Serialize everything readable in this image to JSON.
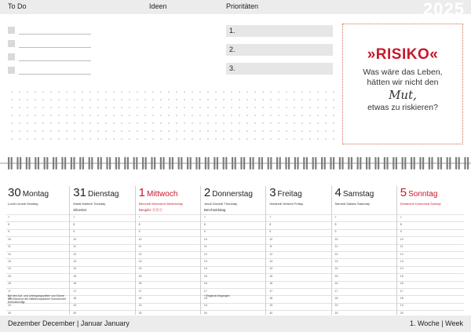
{
  "header": {
    "todo_label": "To Do",
    "ideen_label": "Ideen",
    "prioritaeten_label": "Prioritäten",
    "year": "2025"
  },
  "todo": {
    "count": 4
  },
  "priorities": [
    "1.",
    "2.",
    "3."
  ],
  "quote": {
    "title": "»RISIKO«",
    "line1": "Was wäre das Leben,",
    "line2": "hätten wir nicht den",
    "mut": "Mut,",
    "line3": "etwas zu riskieren?"
  },
  "days": [
    {
      "num": "30",
      "name": "Montag",
      "sub": "Lundi  Lunedì  Monday",
      "event": "",
      "red": false,
      "note": "Bei den Auf- und Untergangszeiten von Sonne und Mond ist die mitteleuropäische Sommerzeit berücksichtigt."
    },
    {
      "num": "31",
      "name": "Dienstag",
      "sub": "Mardi  Martedì  Tuesday",
      "event": "Silvester",
      "red": false,
      "note": ""
    },
    {
      "num": "1",
      "name": "Mittwoch",
      "sub": "Mercredi  Mercoledì  Wednesday",
      "event": "Neujahr  ⓐⓑⓒ",
      "red": true,
      "note": ""
    },
    {
      "num": "2",
      "name": "Donnerstag",
      "sub": "Jeudi  Giovedì  Thursday",
      "event": "Berchtoldstag",
      "red": false,
      "note": "* Regional begangen"
    },
    {
      "num": "3",
      "name": "Freitag",
      "sub": "Vendredi  Venerdì  Friday",
      "event": "",
      "red": false,
      "note": ""
    },
    {
      "num": "4",
      "name": "Samstag",
      "sub": "Samedi  Sabato  Saturday",
      "event": "",
      "red": false,
      "note": ""
    },
    {
      "num": "5",
      "name": "Sonntag",
      "sub": "Dimanche  Domenica  Sunday",
      "event": "",
      "red": true,
      "note": ""
    }
  ],
  "hours": [
    "7",
    "8",
    "9",
    "10",
    "11",
    "12",
    "13",
    "14",
    "15",
    "16",
    "17",
    "18",
    "19",
    "20"
  ],
  "footer": {
    "months": "Dezember  December  |  Januar  January",
    "week": "1. Woche | Week"
  }
}
